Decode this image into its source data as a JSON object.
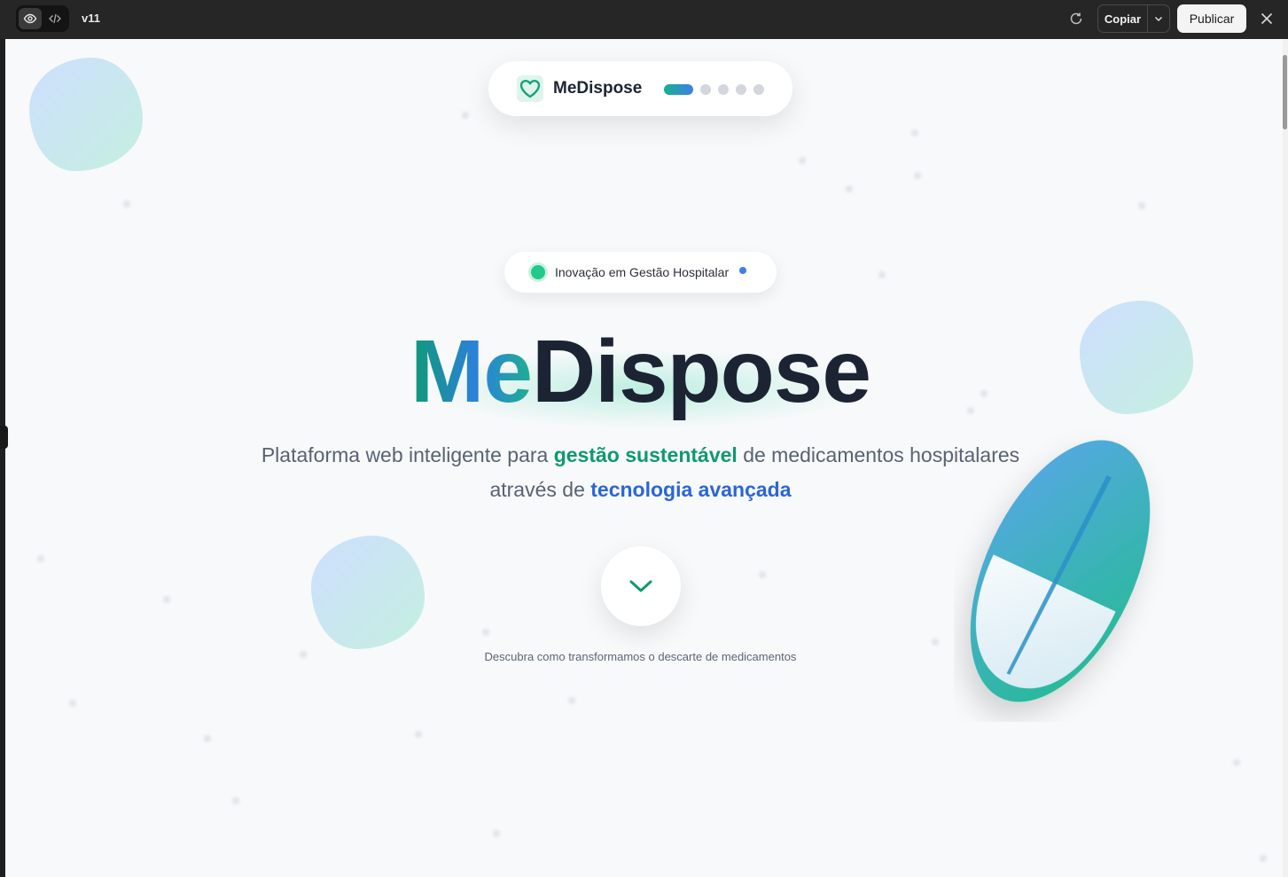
{
  "editor": {
    "version": "v11",
    "copy_label": "Copiar",
    "publish_label": "Publicar"
  },
  "nav": {
    "brand": "MeDispose",
    "steps": 5,
    "active_step": 1
  },
  "badge": {
    "text": "Inovação em Gestão Hospitalar"
  },
  "hero": {
    "title_part1": "Me",
    "title_part2": "Dispose",
    "subtitle_pre": "Plataforma web inteligente para ",
    "subtitle_hl1": "gestão sustentável",
    "subtitle_mid": " de medicamentos hospitalares",
    "subtitle_line2_pre": "através de ",
    "subtitle_hl2": "tecnologia avançada"
  },
  "scroll": {
    "caption": "Descubra como transformamos o descarte de medicamentos",
    "icon": "chevron-down-icon"
  },
  "colors": {
    "accent_green": "#0f9a6c",
    "accent_blue": "#2a66d6",
    "brand_dark": "#1c2434",
    "background": "#f8f9fb"
  }
}
